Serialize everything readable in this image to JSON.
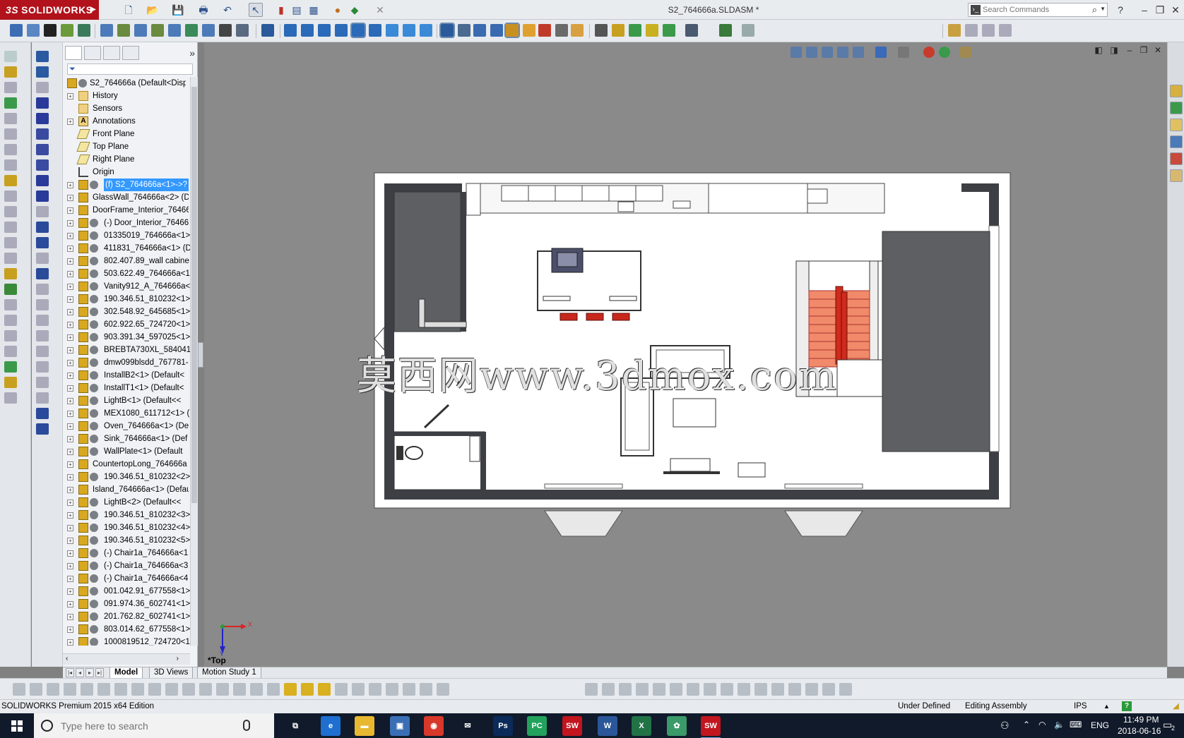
{
  "app": {
    "logo_text": "SOLIDWORKS",
    "logo_prefix": "3S",
    "document_title": "S2_764666a.SLDASM *",
    "search_placeholder": "Search Commands",
    "brand_color": "#b1121b",
    "window_controls": [
      "?",
      "–",
      "❐",
      "✕"
    ]
  },
  "feature_tree": {
    "root_label": "S2_764666a  (Default<Disp",
    "items": [
      {
        "label": "History",
        "kind": "folder",
        "expandable": true
      },
      {
        "label": "Sensors",
        "kind": "folder",
        "expandable": false
      },
      {
        "label": "Annotations",
        "kind": "annot",
        "expandable": true
      },
      {
        "label": "Front Plane",
        "kind": "plane",
        "expandable": false
      },
      {
        "label": "Top Plane",
        "kind": "plane",
        "expandable": false
      },
      {
        "label": "Right Plane",
        "kind": "plane",
        "expandable": false
      },
      {
        "label": "Origin",
        "kind": "origin",
        "expandable": false
      },
      {
        "label": "(f) S2_764666a<1>->?",
        "kind": "comp",
        "selected": true
      },
      {
        "label": "GlassWall_764666a<2> (D",
        "kind": "asm-only"
      },
      {
        "label": "DoorFrame_Interior_76466",
        "kind": "asm-only"
      },
      {
        "label": "(-) Door_Interior_76466",
        "kind": "comp"
      },
      {
        "label": "01335019_764666a<1>",
        "kind": "comp"
      },
      {
        "label": "411831_764666a<1> (D",
        "kind": "comp"
      },
      {
        "label": "802.407.89_wall cabine",
        "kind": "comp"
      },
      {
        "label": "503.622.49_764666a<1>",
        "kind": "comp"
      },
      {
        "label": "Vanity912_A_764666a<",
        "kind": "comp"
      },
      {
        "label": "190.346.51_810232<1>",
        "kind": "comp"
      },
      {
        "label": "302.548.92_645685<1>",
        "kind": "comp"
      },
      {
        "label": "602.922.65_724720<1>",
        "kind": "comp"
      },
      {
        "label": "903.391.34_597025<1>",
        "kind": "comp"
      },
      {
        "label": "BREBTA730XL_584041-",
        "kind": "comp"
      },
      {
        "label": "dmw099blsdd_767781-",
        "kind": "comp"
      },
      {
        "label": "InstallB2<1> (Default<",
        "kind": "comp"
      },
      {
        "label": "InstallT1<1> (Default<",
        "kind": "comp"
      },
      {
        "label": "LightB<1> (Default<<",
        "kind": "comp"
      },
      {
        "label": "MEX1080_611712<1> (",
        "kind": "comp"
      },
      {
        "label": "Oven_764666a<1> (De",
        "kind": "comp"
      },
      {
        "label": "Sink_764666a<1> (Def",
        "kind": "comp"
      },
      {
        "label": "WallPlate<1> (Default",
        "kind": "comp"
      },
      {
        "label": "CountertopLong_764666a",
        "kind": "asm-only"
      },
      {
        "label": "190.346.51_810232<2>",
        "kind": "comp"
      },
      {
        "label": "Island_764666a<1> (Defau",
        "kind": "asm-only"
      },
      {
        "label": "LightB<2> (Default<<",
        "kind": "comp"
      },
      {
        "label": "190.346.51_810232<3>",
        "kind": "comp"
      },
      {
        "label": "190.346.51_810232<4>",
        "kind": "comp"
      },
      {
        "label": "190.346.51_810232<5>",
        "kind": "comp"
      },
      {
        "label": "(-) Chair1a_764666a<1",
        "kind": "comp"
      },
      {
        "label": "(-) Chair1a_764666a<3",
        "kind": "comp"
      },
      {
        "label": "(-) Chair1a_764666a<4",
        "kind": "comp"
      },
      {
        "label": "001.042.91_677558<1>",
        "kind": "comp"
      },
      {
        "label": "091.974.36_602741<1>",
        "kind": "comp"
      },
      {
        "label": "201.762.82_602741<1>",
        "kind": "comp"
      },
      {
        "label": "803.014.62_677558<1>",
        "kind": "comp"
      },
      {
        "label": "1000819512_724720<1:",
        "kind": "comp"
      }
    ]
  },
  "viewport": {
    "watermark": "莫西网www.3dmox.com",
    "view_name": "*Top",
    "triad_x": "X",
    "triad_y": "Y"
  },
  "bottom_tabs": [
    {
      "label": "Model",
      "active": true
    },
    {
      "label": "3D Views",
      "active": false
    },
    {
      "label": "Motion Study 1",
      "active": false
    }
  ],
  "status": {
    "edition": "SOLIDWORKS Premium 2015 x64 Edition",
    "definition": "Under Defined",
    "mode": "Editing Assembly",
    "units": "IPS"
  },
  "taskbar": {
    "search_placeholder": "Type here to search",
    "apps": [
      {
        "name": "task-view",
        "label": "⧉",
        "color": "#101a2a"
      },
      {
        "name": "edge",
        "label": "e",
        "color": "#1e6fd0"
      },
      {
        "name": "file-explorer",
        "label": "▬",
        "color": "#e8b830"
      },
      {
        "name": "store",
        "label": "▣",
        "color": "#3a6fb5"
      },
      {
        "name": "chrome",
        "label": "◉",
        "color": "#d8382a"
      },
      {
        "name": "mail",
        "label": "✉",
        "color": "#101a2a"
      },
      {
        "name": "photoshop",
        "label": "Ps",
        "color": "#0a2a5a"
      },
      {
        "name": "pycharm",
        "label": "PC",
        "color": "#22a25c"
      },
      {
        "name": "solidworks-2015",
        "label": "SW",
        "color": "#c2151e"
      },
      {
        "name": "word",
        "label": "W",
        "color": "#2b579a"
      },
      {
        "name": "excel",
        "label": "X",
        "color": "#217346"
      },
      {
        "name": "app-green",
        "label": "✿",
        "color": "#3a9a6a"
      },
      {
        "name": "solidworks-2015-active",
        "label": "SW",
        "color": "#c2151e",
        "active": true
      }
    ],
    "tray_language": "ENG",
    "time": "11:49 PM",
    "date": "2018-06-16",
    "notifications": "2"
  }
}
